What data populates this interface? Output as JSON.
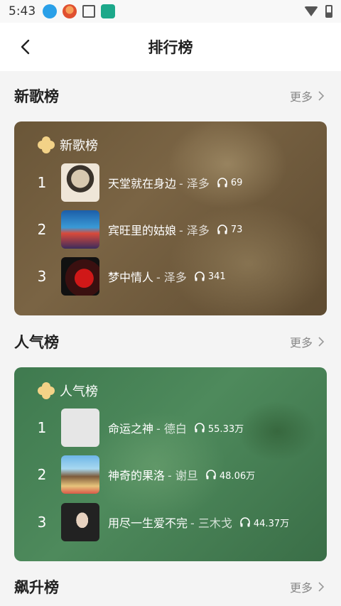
{
  "status_bar": {
    "time": "5:43"
  },
  "app_bar": {
    "title": "排行榜"
  },
  "sections": {
    "new": {
      "title": "新歌榜",
      "more": "更多",
      "card_label": "新歌榜",
      "songs": [
        {
          "rank": "1",
          "name": "天堂就在身边",
          "artist": "- 泽多",
          "plays": "69"
        },
        {
          "rank": "2",
          "name": "宾旺里的姑娘",
          "artist": "- 泽多",
          "plays": "73"
        },
        {
          "rank": "3",
          "name": "梦中情人",
          "artist": "- 泽多",
          "plays": "341"
        }
      ]
    },
    "hot": {
      "title": "人气榜",
      "more": "更多",
      "card_label": "人气榜",
      "songs": [
        {
          "rank": "1",
          "name": "命运之神",
          "artist": "- 德白",
          "plays": "55.33万"
        },
        {
          "rank": "2",
          "name": "神奇的果洛",
          "artist": "- 谢旦",
          "plays": "48.06万"
        },
        {
          "rank": "3",
          "name": "用尽一生爱不完",
          "artist": "- 三木戈",
          "plays": "44.37万"
        }
      ]
    },
    "rising": {
      "title": "飙升榜",
      "more": "更多"
    }
  }
}
